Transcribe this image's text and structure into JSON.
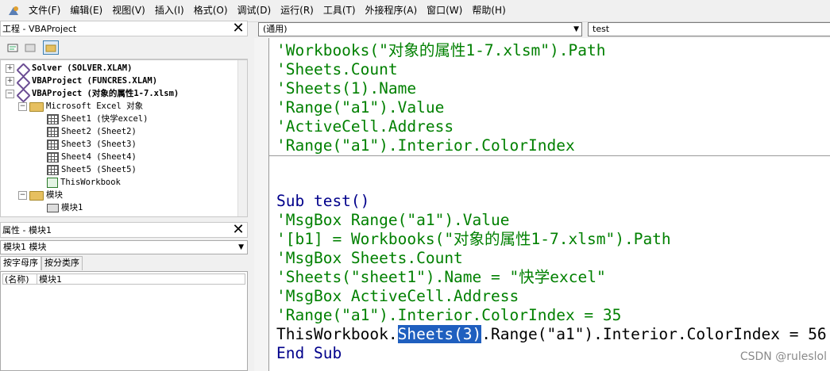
{
  "menu": [
    "文件(F)",
    "编辑(E)",
    "视图(V)",
    "插入(I)",
    "格式(O)",
    "调试(D)",
    "运行(R)",
    "工具(T)",
    "外接程序(A)",
    "窗口(W)",
    "帮助(H)"
  ],
  "project": {
    "title": "工程 - VBAProject",
    "nodes": [
      {
        "label": "Solver (SOLVER.XLAM)"
      },
      {
        "label": "VBAProject (FUNCRES.XLAM)"
      },
      {
        "label": "VBAProject (对象的属性1-7.xlsm)"
      },
      {
        "label": "Microsoft Excel 对象"
      },
      {
        "label": "Sheet1 (快学excel)"
      },
      {
        "label": "Sheet2 (Sheet2)"
      },
      {
        "label": "Sheet3 (Sheet3)"
      },
      {
        "label": "Sheet4 (Sheet4)"
      },
      {
        "label": "Sheet5 (Sheet5)"
      },
      {
        "label": "ThisWorkbook"
      },
      {
        "label": "模块"
      },
      {
        "label": "模块1"
      }
    ]
  },
  "properties": {
    "title": "属性 - 模块1",
    "object_select": "模块1 模块",
    "tabs": [
      "按字母序",
      "按分类序"
    ],
    "rows": [
      {
        "name": "(名称)",
        "value": "模块1"
      }
    ]
  },
  "code": {
    "object_combo": "(通用)",
    "proc_combo": "test",
    "top_lines": [
      "'Workbooks(\"对象的属性1-7.xlsm\").Path",
      "'Sheets.Count",
      "'Sheets(1).Name",
      "'Range(\"a1\").Value",
      "'ActiveCell.Address",
      "'Range(\"a1\").Interior.ColorIndex"
    ],
    "sub_header": "Sub test()",
    "body_lines": [
      "'MsgBox Range(\"a1\").Value",
      "'[b1] = Workbooks(\"对象的属性1-7.xlsm\").Path",
      "'MsgBox Sheets.Count",
      "'Sheets(\"sheet1\").Name = \"快学excel\"",
      "'MsgBox ActiveCell.Address",
      "'Range(\"a1\").Interior.ColorIndex = 35"
    ],
    "last_line_pre": "ThisWorkbook.",
    "last_line_sel": "Sheets(3)",
    "last_line_post": ".Range(\"a1\").Interior.ColorIndex = 56",
    "end_line": "End Sub"
  },
  "watermark": "CSDN @ruleslol"
}
